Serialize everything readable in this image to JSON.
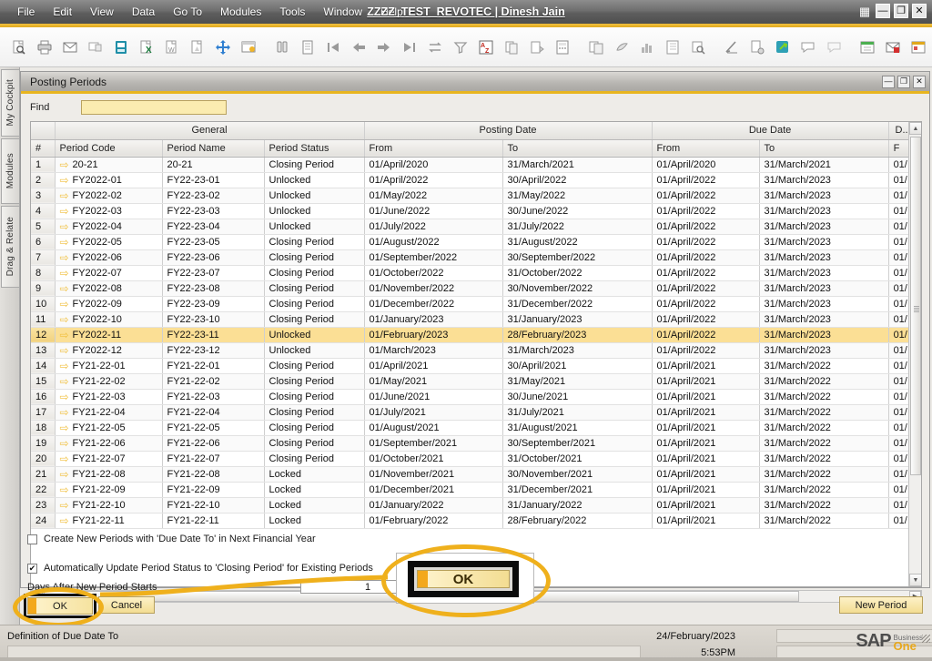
{
  "window": {
    "title": "ZZZZ_TEST_REVOTEC | Dinesh Jain",
    "controls": {
      "grid": "▦",
      "minimize": "—",
      "restore": "❐",
      "close": "✕"
    }
  },
  "menu": [
    {
      "label": "File",
      "accel": "F"
    },
    {
      "label": "Edit",
      "accel": "E"
    },
    {
      "label": "View",
      "accel": "V"
    },
    {
      "label": "Data",
      "accel": "D"
    },
    {
      "label": "Go To",
      "accel": "G"
    },
    {
      "label": "Modules",
      "accel": "M"
    },
    {
      "label": "Tools",
      "accel": "T"
    },
    {
      "label": "Window",
      "accel": "W"
    },
    {
      "label": "Help",
      "accel": "H"
    }
  ],
  "toolbar": [
    "preview-icon",
    "print-icon",
    "email-icon",
    "sms-icon",
    "fax-icon",
    "export-excel-icon",
    "export-word-icon",
    "export-pdf-icon",
    "launch-app-icon",
    "lock-screen-icon",
    "sep",
    "find-icon",
    "add-icon",
    "first-record-icon",
    "previous-record-icon",
    "next-record-icon",
    "last-record-icon",
    "refresh-icon",
    "filter-icon",
    "sort-icon",
    "copy-icon",
    "paste-icon",
    "calculator-icon",
    "sep",
    "report-icon",
    "drag-relate-icon",
    "chart-icon",
    "journal-icon",
    "query-icon",
    "sep",
    "signature-icon",
    "document-settings-icon",
    "service-icon",
    "messages-icon",
    "alerts-icon",
    "sep",
    "calendar-icon",
    "mail-alert-icon",
    "schedule-icon"
  ],
  "sidebar": {
    "tabs": [
      {
        "label": "My Cockpit"
      },
      {
        "label": "Modules"
      },
      {
        "label": "Drag & Relate"
      }
    ]
  },
  "dialog": {
    "title": "Posting Periods",
    "controls": {
      "minimize": "—",
      "restore": "❐",
      "close": "✕"
    },
    "find": {
      "label": "Find",
      "value": "",
      "placeholder": ""
    },
    "expand_icon": "expand-arrow-icon"
  },
  "grid": {
    "group_headers": [
      {
        "label": "",
        "span": 1
      },
      {
        "label": "General",
        "span": 3
      },
      {
        "label": "Posting Date",
        "span": 2
      },
      {
        "label": "Due Date",
        "span": 2
      },
      {
        "label": "D...",
        "span": 1
      }
    ],
    "columns": [
      "#",
      "Period Code",
      "Period Name",
      "Period Status",
      "From",
      "To",
      "From",
      "To",
      "F"
    ],
    "selected_row_index": 12,
    "rows": [
      {
        "n": "1",
        "code": "20-21",
        "name": "20-21",
        "status": "Closing Period",
        "pfrom": "01/April/2020",
        "pto": "31/March/2021",
        "dfrom": "01/April/2020",
        "dto": "31/March/2021",
        "extra": "01/"
      },
      {
        "n": "2",
        "code": "FY2022-01",
        "name": "FY22-23-01",
        "status": "Unlocked",
        "pfrom": "01/April/2022",
        "pto": "30/April/2022",
        "dfrom": "01/April/2022",
        "dto": "31/March/2023",
        "extra": "01/"
      },
      {
        "n": "3",
        "code": "FY2022-02",
        "name": "FY22-23-02",
        "status": "Unlocked",
        "pfrom": "01/May/2022",
        "pto": "31/May/2022",
        "dfrom": "01/April/2022",
        "dto": "31/March/2023",
        "extra": "01/"
      },
      {
        "n": "4",
        "code": "FY2022-03",
        "name": "FY22-23-03",
        "status": "Unlocked",
        "pfrom": "01/June/2022",
        "pto": "30/June/2022",
        "dfrom": "01/April/2022",
        "dto": "31/March/2023",
        "extra": "01/"
      },
      {
        "n": "5",
        "code": "FY2022-04",
        "name": "FY22-23-04",
        "status": "Unlocked",
        "pfrom": "01/July/2022",
        "pto": "31/July/2022",
        "dfrom": "01/April/2022",
        "dto": "31/March/2023",
        "extra": "01/"
      },
      {
        "n": "6",
        "code": "FY2022-05",
        "name": "FY22-23-05",
        "status": "Closing Period",
        "pfrom": "01/August/2022",
        "pto": "31/August/2022",
        "dfrom": "01/April/2022",
        "dto": "31/March/2023",
        "extra": "01/"
      },
      {
        "n": "7",
        "code": "FY2022-06",
        "name": "FY22-23-06",
        "status": "Closing Period",
        "pfrom": "01/September/2022",
        "pto": "30/September/2022",
        "dfrom": "01/April/2022",
        "dto": "31/March/2023",
        "extra": "01/"
      },
      {
        "n": "8",
        "code": "FY2022-07",
        "name": "FY22-23-07",
        "status": "Closing Period",
        "pfrom": "01/October/2022",
        "pto": "31/October/2022",
        "dfrom": "01/April/2022",
        "dto": "31/March/2023",
        "extra": "01/"
      },
      {
        "n": "9",
        "code": "FY2022-08",
        "name": "FY22-23-08",
        "status": "Closing Period",
        "pfrom": "01/November/2022",
        "pto": "30/November/2022",
        "dfrom": "01/April/2022",
        "dto": "31/March/2023",
        "extra": "01/"
      },
      {
        "n": "10",
        "code": "FY2022-09",
        "name": "FY22-23-09",
        "status": "Closing Period",
        "pfrom": "01/December/2022",
        "pto": "31/December/2022",
        "dfrom": "01/April/2022",
        "dto": "31/March/2023",
        "extra": "01/"
      },
      {
        "n": "11",
        "code": "FY2022-10",
        "name": "FY22-23-10",
        "status": "Closing Period",
        "pfrom": "01/January/2023",
        "pto": "31/January/2023",
        "dfrom": "01/April/2022",
        "dto": "31/March/2023",
        "extra": "01/"
      },
      {
        "n": "12",
        "code": "FY2022-11",
        "name": "FY22-23-11",
        "status": "Unlocked",
        "pfrom": "01/February/2023",
        "pto": "28/February/2023",
        "dfrom": "01/April/2022",
        "dto": "31/March/2023",
        "extra": "01/"
      },
      {
        "n": "13",
        "code": "FY2022-12",
        "name": "FY22-23-12",
        "status": "Unlocked",
        "pfrom": "01/March/2023",
        "pto": "31/March/2023",
        "dfrom": "01/April/2022",
        "dto": "31/March/2023",
        "extra": "01/"
      },
      {
        "n": "14",
        "code": "FY21-22-01",
        "name": "FY21-22-01",
        "status": "Closing Period",
        "pfrom": "01/April/2021",
        "pto": "30/April/2021",
        "dfrom": "01/April/2021",
        "dto": "31/March/2022",
        "extra": "01/"
      },
      {
        "n": "15",
        "code": "FY21-22-02",
        "name": "FY21-22-02",
        "status": "Closing Period",
        "pfrom": "01/May/2021",
        "pto": "31/May/2021",
        "dfrom": "01/April/2021",
        "dto": "31/March/2022",
        "extra": "01/"
      },
      {
        "n": "16",
        "code": "FY21-22-03",
        "name": "FY21-22-03",
        "status": "Closing Period",
        "pfrom": "01/June/2021",
        "pto": "30/June/2021",
        "dfrom": "01/April/2021",
        "dto": "31/March/2022",
        "extra": "01/"
      },
      {
        "n": "17",
        "code": "FY21-22-04",
        "name": "FY21-22-04",
        "status": "Closing Period",
        "pfrom": "01/July/2021",
        "pto": "31/July/2021",
        "dfrom": "01/April/2021",
        "dto": "31/March/2022",
        "extra": "01/"
      },
      {
        "n": "18",
        "code": "FY21-22-05",
        "name": "FY21-22-05",
        "status": "Closing Period",
        "pfrom": "01/August/2021",
        "pto": "31/August/2021",
        "dfrom": "01/April/2021",
        "dto": "31/March/2022",
        "extra": "01/"
      },
      {
        "n": "19",
        "code": "FY21-22-06",
        "name": "FY21-22-06",
        "status": "Closing Period",
        "pfrom": "01/September/2021",
        "pto": "30/September/2021",
        "dfrom": "01/April/2021",
        "dto": "31/March/2022",
        "extra": "01/"
      },
      {
        "n": "20",
        "code": "FY21-22-07",
        "name": "FY21-22-07",
        "status": "Closing Period",
        "pfrom": "01/October/2021",
        "pto": "31/October/2021",
        "dfrom": "01/April/2021",
        "dto": "31/March/2022",
        "extra": "01/"
      },
      {
        "n": "21",
        "code": "FY21-22-08",
        "name": "FY21-22-08",
        "status": "Locked",
        "pfrom": "01/November/2021",
        "pto": "30/November/2021",
        "dfrom": "01/April/2021",
        "dto": "31/March/2022",
        "extra": "01/"
      },
      {
        "n": "22",
        "code": "FY21-22-09",
        "name": "FY21-22-09",
        "status": "Locked",
        "pfrom": "01/December/2021",
        "pto": "31/December/2021",
        "dfrom": "01/April/2021",
        "dto": "31/March/2022",
        "extra": "01/"
      },
      {
        "n": "23",
        "code": "FY21-22-10",
        "name": "FY21-22-10",
        "status": "Locked",
        "pfrom": "01/January/2022",
        "pto": "31/January/2022",
        "dfrom": "01/April/2021",
        "dto": "31/March/2022",
        "extra": "01/"
      },
      {
        "n": "24",
        "code": "FY21-22-11",
        "name": "FY21-22-11",
        "status": "Locked",
        "pfrom": "01/February/2022",
        "pto": "28/February/2022",
        "dfrom": "01/April/2021",
        "dto": "31/March/2022",
        "extra": "01/"
      }
    ]
  },
  "options": {
    "create_new_periods": {
      "label": "Create New Periods with 'Due Date To' in Next Financial Year",
      "checked": false,
      "mark": ""
    },
    "auto_update_status": {
      "label": "Automatically Update Period Status to 'Closing Period' for Existing Periods",
      "checked": true,
      "mark": "✔"
    },
    "days_after": {
      "label": "Days After New Period Starts",
      "value": "1"
    }
  },
  "buttons": {
    "ok": "OK",
    "cancel": "Cancel",
    "new_period": "New Period",
    "callout_ok": "OK"
  },
  "statusbar": {
    "message": "Definition of Due Date To",
    "date": "24/February/2023",
    "time": "5:53PM",
    "logo_sap": "SAP",
    "logo_business": "Business",
    "logo_one": "One"
  },
  "colors": {
    "accent_gold": "#e8b51f",
    "selection": "#fbdf95",
    "titlebar": "#6e6e6e",
    "callout_ring": "#efb01c"
  }
}
